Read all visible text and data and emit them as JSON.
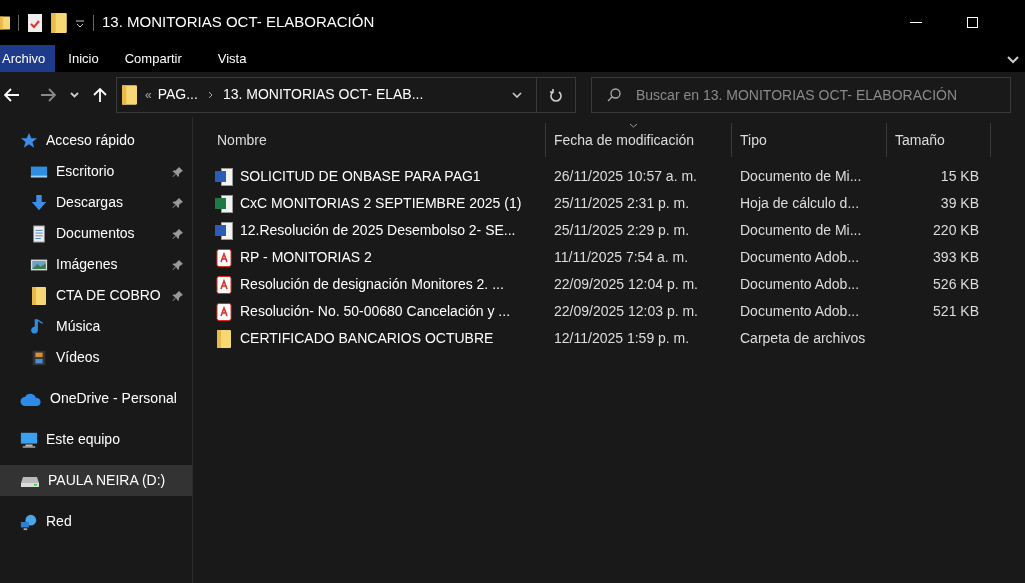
{
  "window": {
    "title": "13. MONITORIAS OCT- ELABORACIÓN"
  },
  "ribbon_tabs": [
    {
      "label": "Archivo",
      "selected": true
    },
    {
      "label": "Inicio",
      "selected": false
    },
    {
      "label": "Compartir",
      "selected": false
    },
    {
      "label": "Vista",
      "selected": false
    }
  ],
  "address_bar": {
    "overflow": "«",
    "segments": [
      "PAG...",
      "13. MONITORIAS OCT- ELAB..."
    ]
  },
  "search": {
    "placeholder": "Buscar en 13. MONITORIAS OCT- ELABORACIÓN"
  },
  "sidebar": {
    "items": [
      {
        "label": "Acceso rápido",
        "kind": "star",
        "pinned": false,
        "selected": false,
        "children": [
          {
            "label": "Escritorio",
            "kind": "desktop",
            "pinned": true,
            "selected": false
          },
          {
            "label": "Descargas",
            "kind": "download",
            "pinned": true,
            "selected": false
          },
          {
            "label": "Documentos",
            "kind": "documents",
            "pinned": true,
            "selected": false
          },
          {
            "label": "Imágenes",
            "kind": "pictures",
            "pinned": true,
            "selected": false
          },
          {
            "label": "CTA DE COBRO",
            "kind": "folder",
            "pinned": true,
            "selected": false
          },
          {
            "label": "Música",
            "kind": "music",
            "pinned": false,
            "selected": false
          },
          {
            "label": "Vídeos",
            "kind": "videos",
            "pinned": false,
            "selected": false
          }
        ]
      },
      {
        "label": "OneDrive - Personal",
        "kind": "cloud",
        "pinned": false,
        "selected": false
      },
      {
        "label": "Este equipo",
        "kind": "computer",
        "pinned": false,
        "selected": false
      },
      {
        "label": "PAULA NEIRA (D:)",
        "kind": "drive",
        "pinned": false,
        "selected": true
      },
      {
        "label": "Red",
        "kind": "network",
        "pinned": false,
        "selected": false
      }
    ]
  },
  "table": {
    "columns": [
      {
        "label": "Nombre",
        "sorted": false
      },
      {
        "label": "Fecha de modificación",
        "sorted": true
      },
      {
        "label": "Tipo",
        "sorted": false
      },
      {
        "label": "Tamaño",
        "sorted": false
      }
    ],
    "rows": [
      {
        "kind": "word",
        "name": "SOLICITUD DE ONBASE PARA PAG1",
        "date": "26/11/2025 10:57 a. m.",
        "type": "Documento de Mi...",
        "size": "15 KB"
      },
      {
        "kind": "excel",
        "name": "CxC MONITORIAS 2 SEPTIEMBRE 2025 (1)",
        "date": "25/11/2025 2:31 p. m.",
        "type": "Hoja de cálculo d...",
        "size": "39 KB"
      },
      {
        "kind": "word",
        "name": "12.Resolución de 2025 Desembolso 2- SE...",
        "date": "25/11/2025 2:29 p. m.",
        "type": "Documento de Mi...",
        "size": "220 KB"
      },
      {
        "kind": "pdf",
        "name": "RP - MONITORIAS 2",
        "date": "11/11/2025 7:54 a. m.",
        "type": "Documento Adob...",
        "size": "393 KB"
      },
      {
        "kind": "pdf",
        "name": "Resolución de designación Monitores 2. ...",
        "date": "22/09/2025 12:04 p. m.",
        "type": "Documento Adob...",
        "size": "526 KB"
      },
      {
        "kind": "pdf",
        "name": "Resolución- No. 50-00680 Cancelación y ...",
        "date": "22/09/2025 12:03 p. m.",
        "type": "Documento Adob...",
        "size": "521 KB"
      },
      {
        "kind": "folder",
        "name": "CERTIFICADO BANCARIOS OCTUBRE",
        "date": "12/11/2025 1:59 p. m.",
        "type": "Carpeta de archivos"
      }
    ]
  }
}
